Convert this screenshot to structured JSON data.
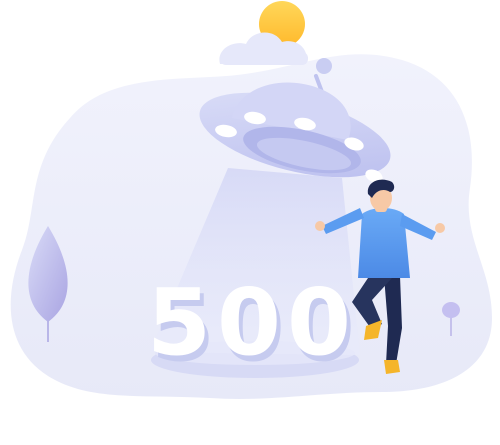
{
  "illustration": {
    "error_code": "500",
    "icons": [
      "sun-icon",
      "cloud-icon",
      "ufo-icon",
      "person-icon",
      "tree-icon",
      "small-tree-icon"
    ],
    "colors": {
      "blob": "#eef0fb",
      "ufo_body": "#c9cdf2",
      "ufo_light": "#b4b9ec",
      "beam": "#dfe2f8",
      "sun": "#ffc93d",
      "shirt": "#5b9cf0",
      "pants": "#23305a",
      "shoes": "#f5b52a",
      "text": "#ffffff",
      "text_shadow": "#c6cbef"
    }
  }
}
